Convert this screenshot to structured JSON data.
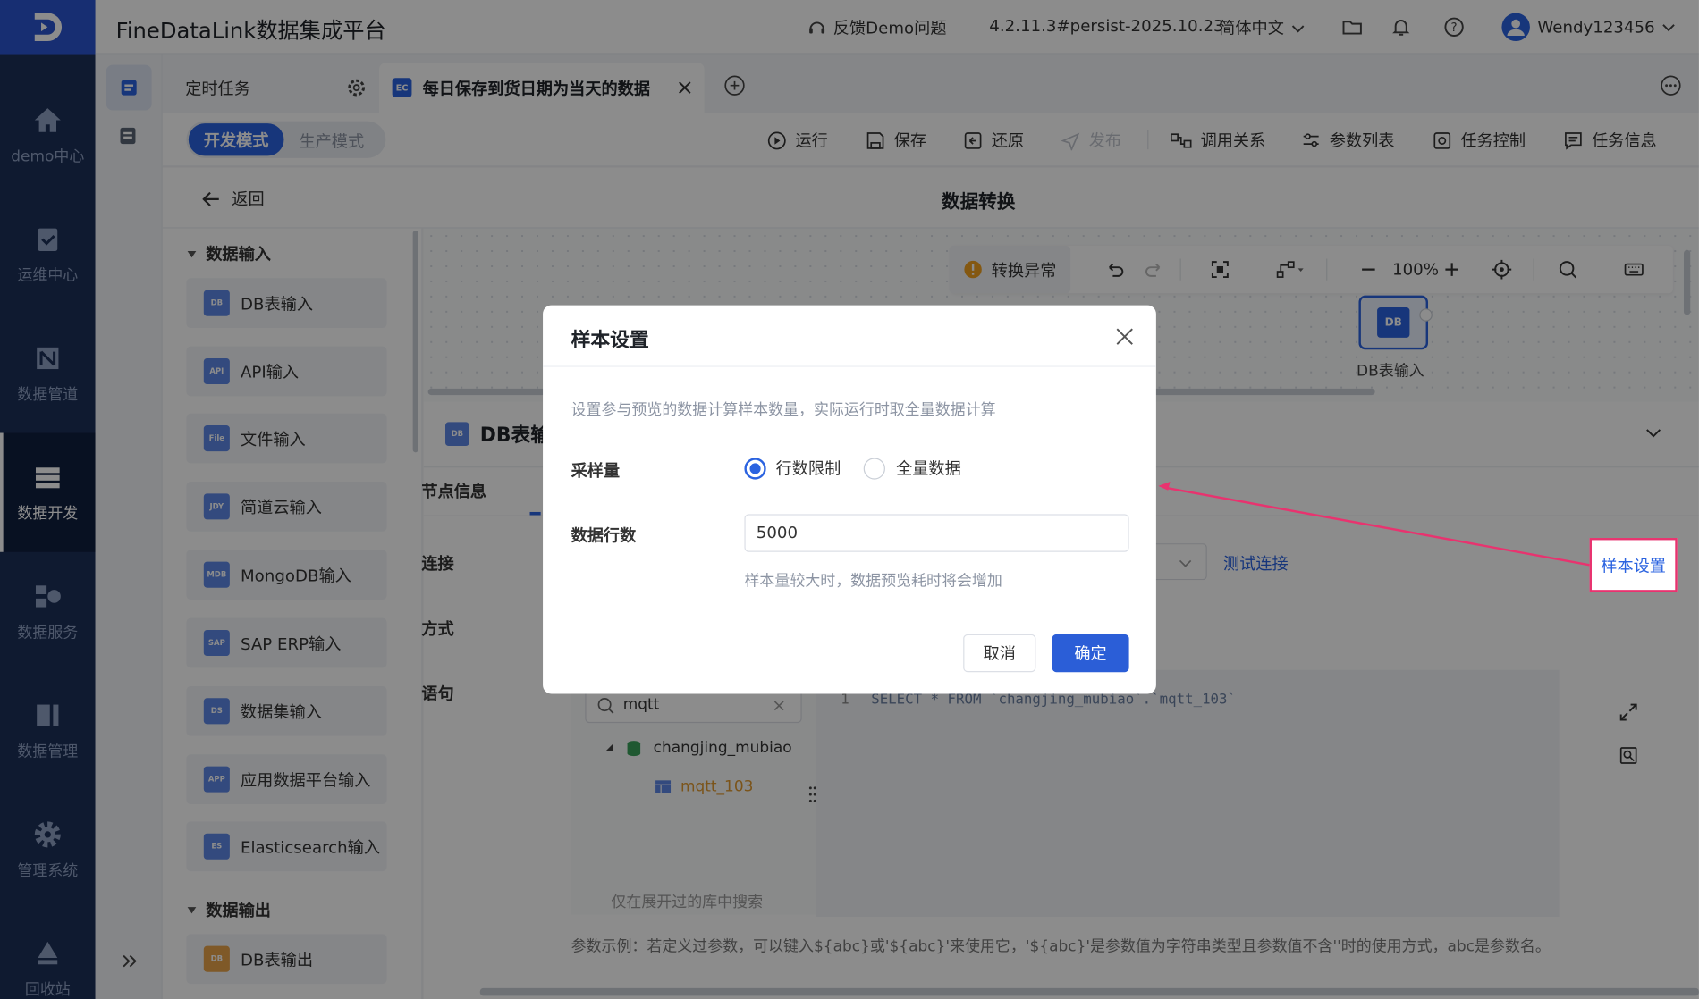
{
  "nav": {
    "items": [
      {
        "label": "demo中心",
        "icon": "home-icon"
      },
      {
        "label": "运维中心",
        "icon": "clipboard-check-icon"
      },
      {
        "label": "数据管道",
        "icon": "pipeline-icon"
      },
      {
        "label": "数据开发",
        "icon": "dev-icon"
      },
      {
        "label": "数据服务",
        "icon": "service-icon"
      },
      {
        "label": "数据管理",
        "icon": "manage-icon"
      },
      {
        "label": "管理系统",
        "icon": "gear-icon"
      },
      {
        "label": "回收站",
        "icon": "recycle-icon"
      }
    ],
    "active": "数据开发"
  },
  "header": {
    "title": "FineDataLink数据集成平台",
    "feedback": "反馈Demo问题",
    "version": "4.2.11.3#persist-2025.10.23",
    "language": "简体中文",
    "user": "Wendy123456"
  },
  "tabs": [
    {
      "label": "定时任务"
    },
    {
      "label": "每日保存到货日期为当天的数据",
      "badge": "EC"
    }
  ],
  "toolbar": {
    "mode_dev": "开发模式",
    "mode_prod": "生产模式",
    "actions": [
      "运行",
      "保存",
      "还原",
      "发布",
      "调用关系",
      "参数列表",
      "任务控制",
      "任务信息"
    ]
  },
  "subheader": {
    "back": "返回",
    "title": "数据转换"
  },
  "palette": {
    "input_section": "数据输入",
    "input_items": [
      {
        "label": "DB表输入",
        "badge": "DB"
      },
      {
        "label": "API输入",
        "badge": "API"
      },
      {
        "label": "文件输入",
        "badge": "File"
      },
      {
        "label": "简道云输入",
        "badge": "JDY"
      },
      {
        "label": "MongoDB输入",
        "badge": "MDB"
      },
      {
        "label": "SAP ERP输入",
        "badge": "SAP"
      },
      {
        "label": "数据集输入",
        "badge": "DS"
      },
      {
        "label": "应用数据平台输入",
        "badge": "APP"
      },
      {
        "label": "Elasticsearch输入",
        "badge": "ES"
      }
    ],
    "output_section": "数据输出",
    "output_items": [
      {
        "label": "DB表输出",
        "badge": "DB"
      }
    ]
  },
  "canvas": {
    "error_label": "转换异常",
    "zoom": "100%",
    "node_label": "DB表输入",
    "node_badge": "DB"
  },
  "props": {
    "title": "DB表输",
    "tab": "节点信息",
    "rows": [
      "连接",
      "方式",
      "语句"
    ],
    "test_conn": "测试连接",
    "sample_settings": "样本设置",
    "search_value": "mqtt",
    "tree_db": "changjing_mubiao",
    "tree_table": "mqtt_103",
    "search_hint": "仅在展开过的库中搜索",
    "sql_line": "1",
    "sql": "SELECT * FROM `changjing_mubiao`.`mqtt_103`",
    "param_example": "参数示例：若定义过参数，可以键入${abc}或'${abc}'来使用它，'${abc}'是参数值为字符串类型且参数值不含''时的使用方式，abc是参数名。"
  },
  "dialog": {
    "title": "样本设置",
    "desc": "设置参与预览的数据计算样本数量，实际运行时取全量数据计算",
    "sample_label": "采样量",
    "option_limit": "行数限制",
    "option_all": "全量数据",
    "rows_label": "数据行数",
    "rows_value": "5000",
    "hint": "样本量较大时，数据预览耗时将会增加",
    "cancel": "取消",
    "ok": "确定"
  },
  "colors": {
    "brand": "#2b63e0",
    "nav_bg": "#1d3058",
    "annotation": "#e8336f"
  }
}
